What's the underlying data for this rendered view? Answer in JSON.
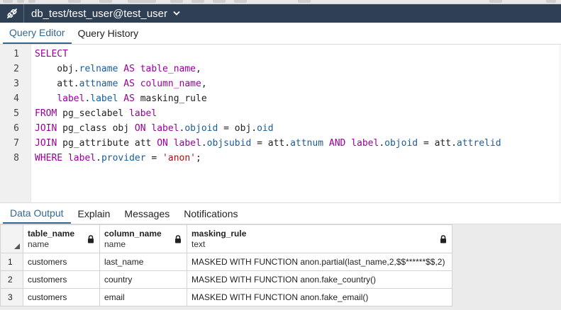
{
  "connection": {
    "title": "db_test/test_user@test_user"
  },
  "editor_tabs": [
    "Query Editor",
    "Query History"
  ],
  "editor": {
    "line_numbers": [
      "1",
      "2",
      "3",
      "4",
      "5",
      "6",
      "7",
      "8"
    ],
    "lines": [
      [
        {
          "t": "SELECT",
          "c": "kw"
        }
      ],
      [
        {
          "t": "    obj."
        },
        {
          "t": "relname",
          "c": "prop"
        },
        {
          "t": " "
        },
        {
          "t": "AS",
          "c": "kw"
        },
        {
          "t": " "
        },
        {
          "t": "table_name",
          "c": "kw"
        },
        {
          "t": ","
        }
      ],
      [
        {
          "t": "    att."
        },
        {
          "t": "attname",
          "c": "prop"
        },
        {
          "t": " "
        },
        {
          "t": "AS",
          "c": "kw"
        },
        {
          "t": " "
        },
        {
          "t": "column_name",
          "c": "kw"
        },
        {
          "t": ","
        }
      ],
      [
        {
          "t": "    "
        },
        {
          "t": "label",
          "c": "kw"
        },
        {
          "t": "."
        },
        {
          "t": "label",
          "c": "prop"
        },
        {
          "t": " "
        },
        {
          "t": "AS",
          "c": "kw"
        },
        {
          "t": " masking_rule"
        }
      ],
      [
        {
          "t": "FROM",
          "c": "kw"
        },
        {
          "t": " pg_seclabel "
        },
        {
          "t": "label",
          "c": "kw"
        }
      ],
      [
        {
          "t": "JOIN",
          "c": "kw"
        },
        {
          "t": " pg_class obj "
        },
        {
          "t": "ON",
          "c": "kw"
        },
        {
          "t": " "
        },
        {
          "t": "label",
          "c": "kw"
        },
        {
          "t": "."
        },
        {
          "t": "objoid",
          "c": "prop"
        },
        {
          "t": " = obj."
        },
        {
          "t": "oid",
          "c": "prop"
        }
      ],
      [
        {
          "t": "JOIN",
          "c": "kw"
        },
        {
          "t": " pg_attribute att "
        },
        {
          "t": "ON",
          "c": "kw"
        },
        {
          "t": " "
        },
        {
          "t": "label",
          "c": "kw"
        },
        {
          "t": "."
        },
        {
          "t": "objsubid",
          "c": "prop"
        },
        {
          "t": " = att."
        },
        {
          "t": "attnum",
          "c": "prop"
        },
        {
          "t": " "
        },
        {
          "t": "AND",
          "c": "kw"
        },
        {
          "t": " "
        },
        {
          "t": "label",
          "c": "kw"
        },
        {
          "t": "."
        },
        {
          "t": "objoid",
          "c": "prop"
        },
        {
          "t": " = att."
        },
        {
          "t": "attrelid",
          "c": "prop"
        }
      ],
      [
        {
          "t": "WHERE",
          "c": "kw"
        },
        {
          "t": " "
        },
        {
          "t": "label",
          "c": "kw"
        },
        {
          "t": "."
        },
        {
          "t": "provider",
          "c": "prop"
        },
        {
          "t": " = "
        },
        {
          "t": "'anon'",
          "c": "str"
        },
        {
          "t": ";"
        }
      ]
    ]
  },
  "output_tabs": [
    "Data Output",
    "Explain",
    "Messages",
    "Notifications"
  ],
  "grid": {
    "columns": [
      {
        "name": "table_name",
        "type": "name"
      },
      {
        "name": "column_name",
        "type": "name"
      },
      {
        "name": "masking_rule",
        "type": "text"
      }
    ],
    "rows": [
      {
        "num": "1",
        "cells": [
          "customers",
          "last_name",
          "MASKED WITH FUNCTION anon.partial(last_name,2,$$******$$,2)"
        ]
      },
      {
        "num": "2",
        "cells": [
          "customers",
          "country",
          "MASKED WITH FUNCTION anon.fake_country()"
        ]
      },
      {
        "num": "3",
        "cells": [
          "customers",
          "email",
          "MASKED WITH FUNCTION anon.fake_email()"
        ]
      }
    ]
  },
  "colors": {
    "header_bg": "#2f3f54",
    "accent": "#326690",
    "keyword": "#990099",
    "property": "#1a5c99",
    "string": "#aa1111"
  },
  "icons": {
    "connection": "plug-icon",
    "dropdown": "chevron-down-icon",
    "lock": "lock-icon",
    "select_all": "triangle-corner-icon"
  }
}
